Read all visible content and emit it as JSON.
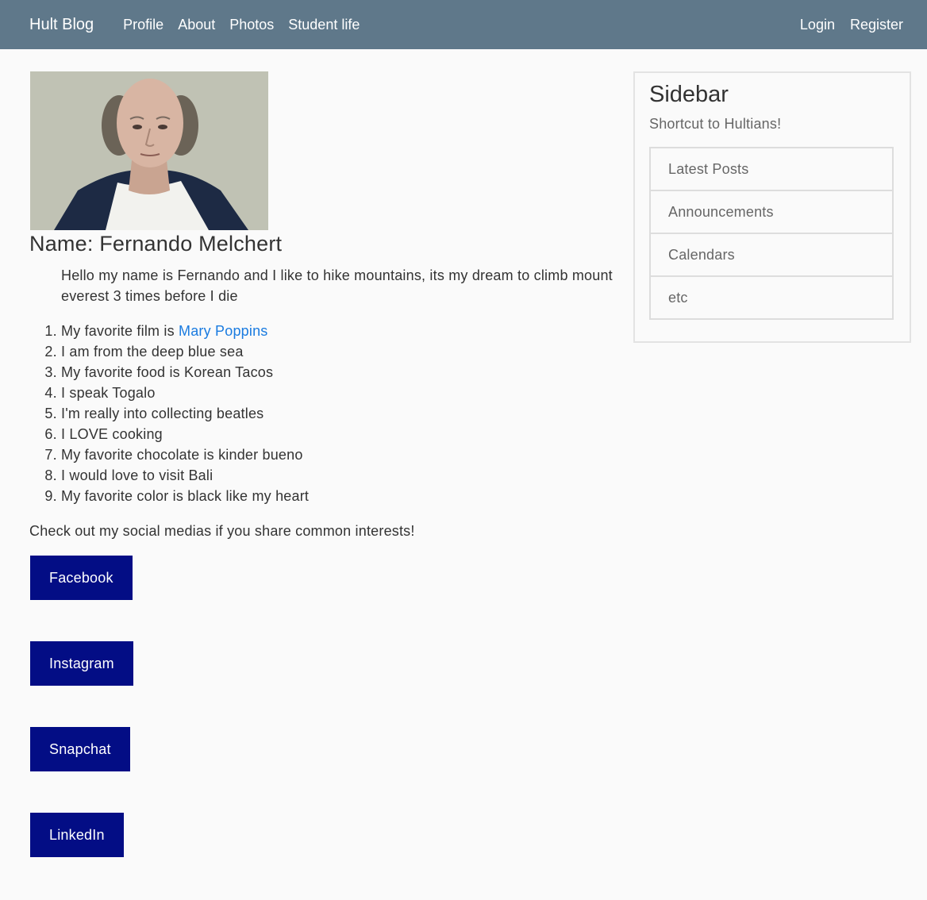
{
  "nav": {
    "brand": "Hult Blog",
    "links": [
      "Profile",
      "About",
      "Photos",
      "Student life"
    ],
    "login": "Login",
    "register": "Register"
  },
  "profile": {
    "name_heading": "Name: Fernando Melchert",
    "bio": "Hello my name is Fernando and I like to hike mountains, its my dream to climb mount everest 3 times before I die",
    "facts": {
      "film_prefix": "My favorite film is ",
      "film_link": "Mary Poppins",
      "items": [
        "I am from the deep blue sea",
        "My favorite food is Korean Tacos",
        "I speak Togalo",
        "I'm really into collecting beatles",
        "I LOVE cooking",
        "My favorite chocolate is kinder bueno",
        "I would love to visit Bali",
        "My favorite color is black like my heart"
      ]
    },
    "social_note": "Check out my social medias if you share common interests!",
    "social_buttons": [
      "Facebook",
      "Instagram",
      "Snapchat",
      "LinkedIn"
    ]
  },
  "sidebar": {
    "title": "Sidebar",
    "subtitle": "Shortcut to Hultians!",
    "items": [
      "Latest Posts",
      "Announcements",
      "Calendars",
      "etc"
    ]
  },
  "colors": {
    "navbar": "#5f788a",
    "button": "#030d85",
    "link": "#1a7be0"
  }
}
